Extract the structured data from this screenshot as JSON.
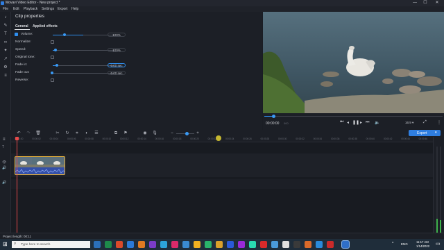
{
  "window": {
    "title": "Movavi Video Editor - New project *",
    "minimize": "—",
    "maximize": "☐",
    "close": "✕"
  },
  "menu": [
    "File",
    "Edit",
    "Playback",
    "Settings",
    "Export",
    "Help"
  ],
  "props": {
    "title": "Clip properties",
    "tabs": [
      "General",
      "Applied effects"
    ],
    "rows": [
      {
        "label": "Volume:",
        "type": "slider",
        "checked": true,
        "value": "100%",
        "level": 0.5
      },
      {
        "label": "Normalize:",
        "type": "check",
        "checked": false
      },
      {
        "label": "Speed:",
        "type": "slider",
        "value": "100%",
        "level": 0.06
      },
      {
        "label": "Original tone:",
        "type": "check",
        "checked": false
      },
      {
        "label": "Fade in:",
        "type": "slider",
        "value": "0.00 sec",
        "level": 0.07
      },
      {
        "label": "Fade out:",
        "type": "slider",
        "value": "0.00 sec",
        "level": 0.0
      },
      {
        "label": "Reverse:",
        "type": "check",
        "checked": false
      }
    ]
  },
  "player": {
    "time_current": "00:00:00",
    "time_frames": "000",
    "aspect": "16:9 ▾",
    "progress": 0.06
  },
  "export_button": "Export",
  "ruler_ticks": [
    "00:00:00",
    "00:00:02",
    "00:00:04",
    "00:00:06",
    "00:00:08",
    "00:00:10",
    "00:00:12",
    "00:00:14",
    "00:00:16",
    "00:00:18",
    "00:00:20",
    "00:00:22",
    "00:00:24",
    "00:00:26",
    "00:00:28",
    "00:00:30",
    "00:00:32",
    "00:00:34",
    "00:00:36",
    "00:00:38",
    "00:00:40",
    "00:00:42",
    "00:00:44",
    "00:00:46"
  ],
  "status": {
    "project_length": "Project length: 00:11"
  },
  "taskbar": {
    "search_placeholder": "Type here to search",
    "time": "11:17 AM",
    "date": "1/14/2022",
    "lang": "ENG"
  },
  "colors": {
    "accent": "#2f8ff0",
    "clip_border": "#e8b23a",
    "playhead": "#e84a4a"
  }
}
